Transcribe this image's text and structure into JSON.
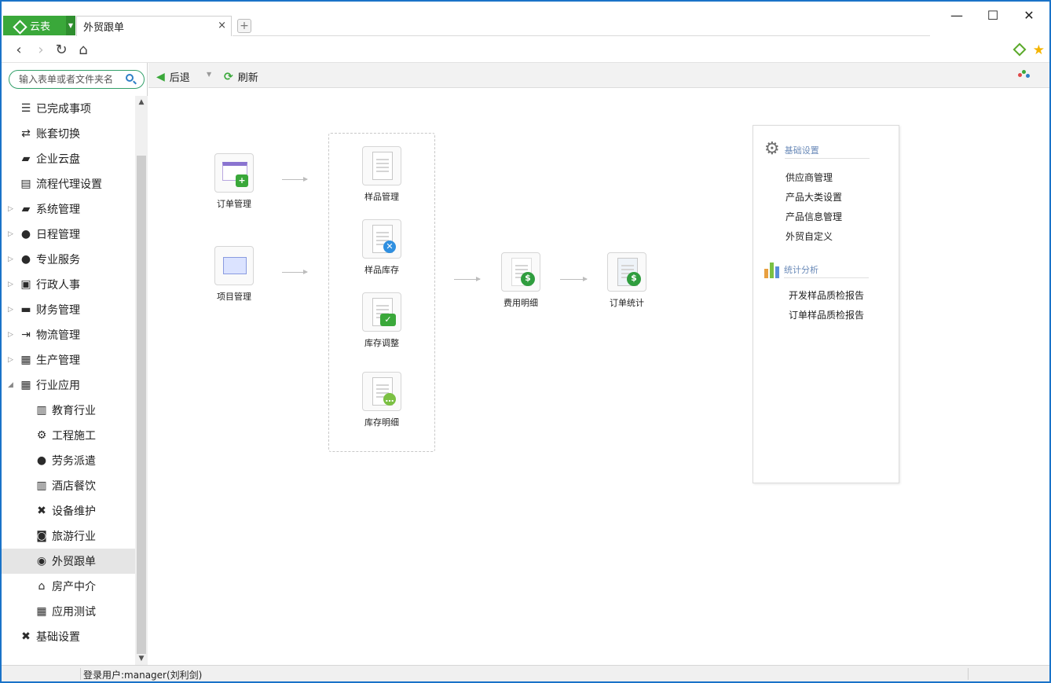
{
  "titlebar": {
    "app_label": "云表",
    "tab_label": "外贸跟单",
    "tab_close": "×",
    "new_tab": "+",
    "minimize": "—",
    "maximize": "☐",
    "close": "✕"
  },
  "toolbar": {
    "back_label": "后退",
    "refresh_label": "刷新"
  },
  "search": {
    "placeholder": "输入表单或者文件夹名"
  },
  "menu": [
    {
      "label": "已完成事项",
      "icon": "list-icon"
    },
    {
      "label": "账套切换",
      "icon": "switch-icon"
    },
    {
      "label": "企业云盘",
      "icon": "folder-icon"
    },
    {
      "label": "流程代理设置",
      "icon": "document-icon"
    },
    {
      "label": "系统管理",
      "icon": "folder-icon"
    },
    {
      "label": "日程管理",
      "icon": "person-icon"
    },
    {
      "label": "专业服务",
      "icon": "person-icon"
    },
    {
      "label": "行政人事",
      "icon": "contact-icon"
    },
    {
      "label": "财务管理",
      "icon": "wallet-icon"
    },
    {
      "label": "物流管理",
      "icon": "forward-icon"
    },
    {
      "label": "生产管理",
      "icon": "factory-icon"
    },
    {
      "label": "行业应用",
      "icon": "grid-icon"
    },
    {
      "label": "教育行业",
      "icon": "building-icon"
    },
    {
      "label": "工程施工",
      "icon": "gear-icon"
    },
    {
      "label": "劳务派遣",
      "icon": "person-icon"
    },
    {
      "label": "酒店餐饮",
      "icon": "building-icon"
    },
    {
      "label": "设备维护",
      "icon": "tools-icon"
    },
    {
      "label": "旅游行业",
      "icon": "bag-icon"
    },
    {
      "label": "外贸跟单",
      "icon": "globe-icon"
    },
    {
      "label": "房产中介",
      "icon": "home-icon"
    },
    {
      "label": "应用测试",
      "icon": "grid-icon"
    },
    {
      "label": "基础设置",
      "icon": "tools-icon"
    }
  ],
  "flow": {
    "order_mgmt": "订单管理",
    "project_mgmt": "项目管理",
    "sample_mgmt": "样品管理",
    "sample_stock": "样品库存",
    "stock_adjust": "库存调整",
    "stock_detail": "库存明细",
    "expense_detail": "费用明细",
    "order_stats": "订单统计"
  },
  "panel": {
    "basic_title": "基础设置",
    "basic_items": [
      "供应商管理",
      "产品大类设置",
      "产品信息管理",
      "外贸自定义"
    ],
    "stats_title": "统计分析",
    "stats_items": [
      "开发样品质检报告",
      "订单样品质检报告"
    ]
  },
  "status": {
    "user": "登录用户:manager(刘利剑)"
  },
  "colors": {
    "accent": "#3aa83a",
    "frame": "#1a73c8",
    "panel_title": "#6a8ab8"
  }
}
